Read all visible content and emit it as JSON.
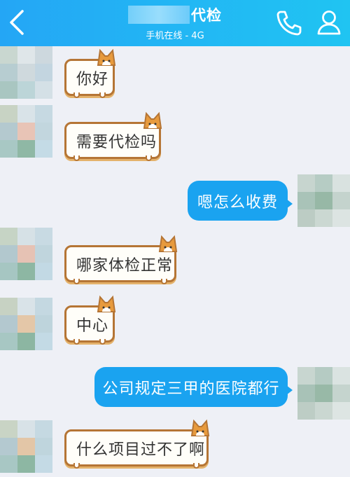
{
  "header": {
    "title": "代检",
    "subtitle": "手机在线 - 4G",
    "icons": {
      "back": "chevron-left-icon",
      "call": "phone-icon",
      "profile": "user-icon"
    }
  },
  "messages": [
    {
      "side": "in",
      "text": "你好"
    },
    {
      "side": "in",
      "text": "需要代检吗"
    },
    {
      "side": "out",
      "text": "嗯怎么收费"
    },
    {
      "side": "in",
      "text": "哪家体检正常"
    },
    {
      "side": "in",
      "text": "中心"
    },
    {
      "side": "out",
      "text": "公司规定三甲的医院都行"
    },
    {
      "side": "in",
      "text": "什么项目过不了啊"
    }
  ],
  "colors": {
    "header_start": "#24a6f5",
    "header_end": "#20c4f2",
    "outgoing_bubble": "#1aa3f0",
    "incoming_border": "#b57535",
    "background": "#eef0f6"
  }
}
